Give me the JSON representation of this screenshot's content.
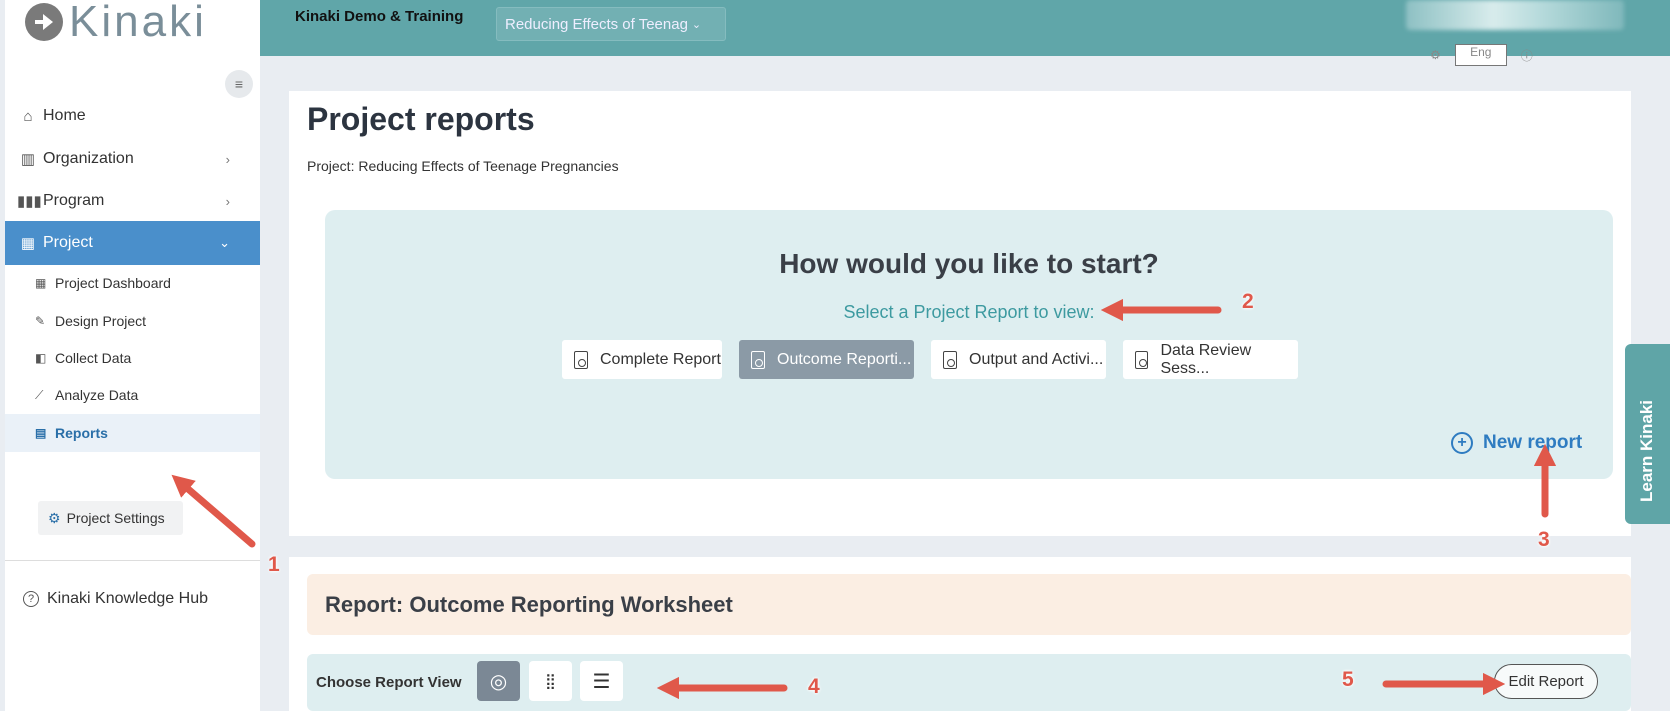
{
  "sidebar": {
    "logo_text": "Kinaki",
    "nav": [
      {
        "label": "Home",
        "icon": "home-icon"
      },
      {
        "label": "Organization",
        "icon": "organization-icon"
      },
      {
        "label": "Program",
        "icon": "program-icon"
      },
      {
        "label": "Project",
        "icon": "project-icon"
      }
    ],
    "sub": [
      {
        "label": "Project Dashboard",
        "icon": "dashboard-icon"
      },
      {
        "label": "Design Project",
        "icon": "pencil-icon"
      },
      {
        "label": "Collect Data",
        "icon": "collect-icon"
      },
      {
        "label": "Analyze Data",
        "icon": "chart-line-icon"
      },
      {
        "label": "Reports",
        "icon": "report-file-icon"
      }
    ],
    "settings_label": "Project Settings",
    "hub_label": "Kinaki Knowledge Hub"
  },
  "topbar": {
    "org_name": "Kinaki Demo & Training",
    "project_select": "Reducing Effects of Teenag",
    "lang_value": "Eng"
  },
  "main": {
    "title": "Project reports",
    "project_line": "Project: Reducing Effects of Teenage Pregnancies",
    "start_heading": "How would you like to start?",
    "select_prompt": "Select a Project Report to view:",
    "reports": [
      "Complete Report",
      "Outcome Reporti...",
      "Output and Activi...",
      "Data Review Sess..."
    ],
    "new_report": "New report",
    "report_header": "Report: Outcome Reporting Worksheet",
    "view_label": "Choose Report View",
    "edit_report": "Edit Report"
  },
  "learn_tab": "Learn Kinaki",
  "annotations": [
    "1",
    "2",
    "3",
    "4",
    "5"
  ],
  "colors": {
    "topbar": "#60a6a9",
    "active_nav": "#4a8fcb",
    "panel": "#deeef0",
    "report_header": "#fbeee3",
    "arrow": "#e0584a",
    "link": "#2f7cc1"
  }
}
